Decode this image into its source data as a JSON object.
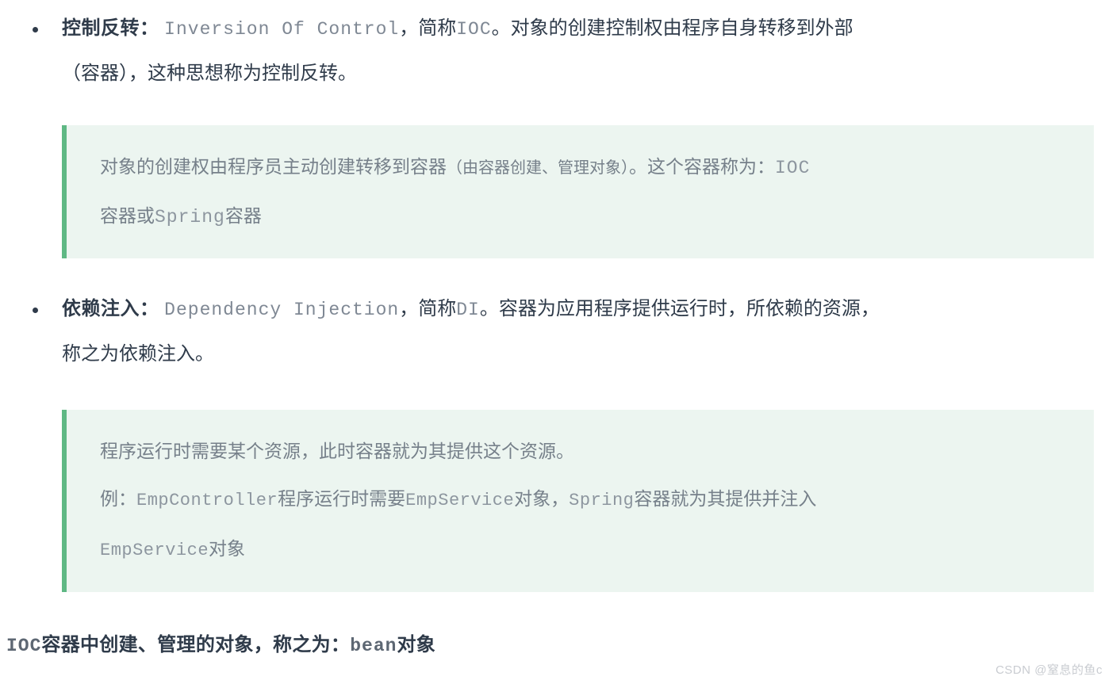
{
  "document": {
    "bullets": [
      {
        "term": "控制反转",
        "colon": "：",
        "code": "Inversion Of Control",
        "rest_line1": "，简称",
        "abbr": "IOC",
        "rest_line1_tail": "。对象的创建控制权由程序自身转移到外部",
        "line2": "（容器），这种思想称为控制反转。"
      },
      {
        "term": "依赖注入",
        "colon": "：",
        "code": "Dependency Injection",
        "rest_line1": "，简称",
        "abbr": "DI",
        "rest_line1_tail": "。容器为应用程序提供运行时，所依赖的资源，",
        "line2": "称之为依赖注入。"
      }
    ],
    "quotes": [
      {
        "line1_a": "对象的创建权由程序员主动创建转移到容器",
        "line1_paren": "（由容器创建、管理对象）",
        "line1_b": "。这个容器称为：",
        "line1_code": "IOC",
        "line2_a": "容器或",
        "line2_code": "Spring",
        "line2_b": "容器"
      },
      {
        "line1": "程序运行时需要某个资源，此时容器就为其提供这个资源。",
        "line2_label": "例：",
        "line2_code1": "EmpController",
        "line2_a": "程序运行时需要",
        "line2_code2": "EmpService",
        "line2_b": "对象，",
        "line2_code3": "Spring",
        "line2_c": "容器就为其提供并注入",
        "line3_code": "EmpService",
        "line3_tail": "对象"
      }
    ],
    "footer": {
      "code_prefix": "IOC",
      "text_a": "容器中创建、管理的对象，称之为：",
      "code_bean": "bean",
      "text_b": "对象"
    },
    "watermark": "CSDN @窒息的鱼c"
  },
  "colors": {
    "text": "#2f3b4a",
    "code": "#7f8894",
    "quote_bg": "#ecf5f0",
    "quote_border": "#5fb884",
    "quote_text": "#76808a",
    "watermark": "#c9ccd1"
  }
}
